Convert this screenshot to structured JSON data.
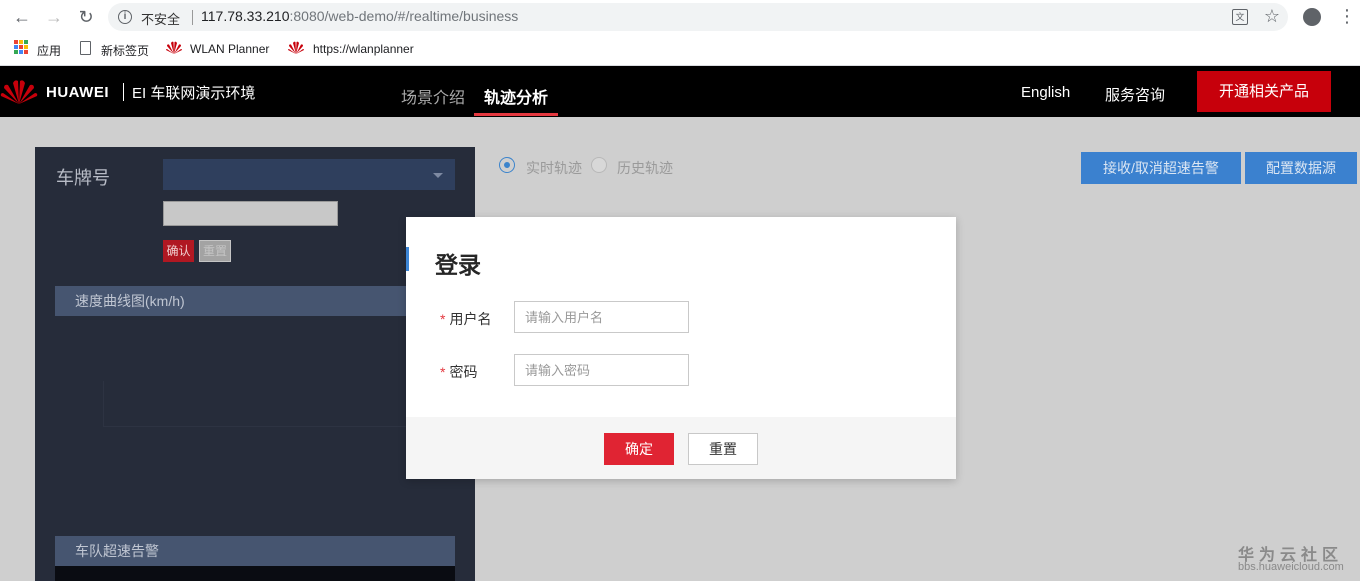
{
  "browser": {
    "insecure_label": "不安全",
    "url_host": "117.78.33.210",
    "url_rest": ":8080/web-demo/#/realtime/business",
    "bookmarks": [
      "应用",
      "新标签页",
      "WLAN Planner",
      "https://wlanplanner"
    ]
  },
  "header": {
    "brand": "HUAWEI",
    "subtitle": "EI 车联网演示环境",
    "nav_intro": "场景介绍",
    "nav_track": "轨迹分析",
    "english": "English",
    "consult": "服务咨询",
    "cta": "开通相关产品"
  },
  "left_panel": {
    "plate_label": "车牌号",
    "confirm": "确认",
    "reset": "重置",
    "speed_chart_title": "速度曲线图(km/h)",
    "fleet_alarm_title": "车队超速告警"
  },
  "controls": {
    "realtime": "实时轨迹",
    "history": "历史轨迹",
    "toggle_alarm": "接收/取消超速告警",
    "config_source": "配置数据源"
  },
  "modal": {
    "title": "登录",
    "username_label": "用户名",
    "username_placeholder": "请输入用户名",
    "password_label": "密码",
    "password_placeholder": "请输入密码",
    "ok": "确定",
    "reset": "重置"
  },
  "watermark": {
    "main": "华为云社区",
    "sub": "bbs.huaweicloud.com"
  },
  "colors": {
    "brand_red": "#c7000b",
    "accent_blue": "#3b81cf",
    "panel_dark": "#262c3a"
  }
}
